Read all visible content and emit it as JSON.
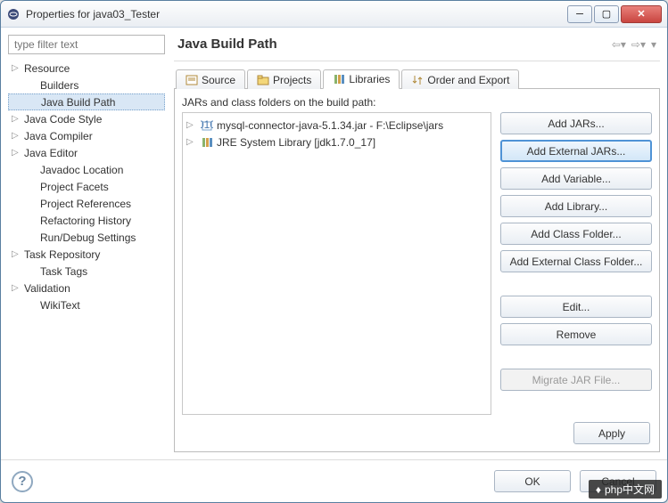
{
  "window": {
    "title": "Properties for java03_Tester"
  },
  "filter": {
    "placeholder": "type filter text"
  },
  "tree": {
    "items": [
      {
        "label": "Resource",
        "expandable": true,
        "child": false
      },
      {
        "label": "Builders",
        "expandable": false,
        "child": true
      },
      {
        "label": "Java Build Path",
        "expandable": false,
        "child": true,
        "selected": true
      },
      {
        "label": "Java Code Style",
        "expandable": true,
        "child": false
      },
      {
        "label": "Java Compiler",
        "expandable": true,
        "child": false
      },
      {
        "label": "Java Editor",
        "expandable": true,
        "child": false
      },
      {
        "label": "Javadoc Location",
        "expandable": false,
        "child": true
      },
      {
        "label": "Project Facets",
        "expandable": false,
        "child": true
      },
      {
        "label": "Project References",
        "expandable": false,
        "child": true
      },
      {
        "label": "Refactoring History",
        "expandable": false,
        "child": true
      },
      {
        "label": "Run/Debug Settings",
        "expandable": false,
        "child": true
      },
      {
        "label": "Task Repository",
        "expandable": true,
        "child": false
      },
      {
        "label": "Task Tags",
        "expandable": false,
        "child": true
      },
      {
        "label": "Validation",
        "expandable": true,
        "child": false
      },
      {
        "label": "WikiText",
        "expandable": false,
        "child": true
      }
    ]
  },
  "main": {
    "title": "Java Build Path"
  },
  "tabs": [
    {
      "label": "Source",
      "icon": "source-icon"
    },
    {
      "label": "Projects",
      "icon": "projects-icon"
    },
    {
      "label": "Libraries",
      "icon": "libraries-icon",
      "active": true
    },
    {
      "label": "Order and Export",
      "icon": "order-icon"
    }
  ],
  "libraries": {
    "heading": "JARs and class folders on the build path:",
    "items": [
      {
        "label": "mysql-connector-java-5.1.34.jar - F:\\Eclipse\\jars",
        "icon": "jar-file-icon"
      },
      {
        "label": "JRE System Library [jdk1.7.0_17]",
        "icon": "jre-library-icon"
      }
    ]
  },
  "buttons": {
    "add_jars": "Add JARs...",
    "add_external_jars": "Add External JARs...",
    "add_variable": "Add Variable...",
    "add_library": "Add Library...",
    "add_class_folder": "Add Class Folder...",
    "add_external_class_folder": "Add External Class Folder...",
    "edit": "Edit...",
    "remove": "Remove",
    "migrate": "Migrate JAR File...",
    "apply": "Apply",
    "ok": "OK",
    "cancel": "Cancel"
  },
  "watermark": {
    "text": "php中文网"
  }
}
